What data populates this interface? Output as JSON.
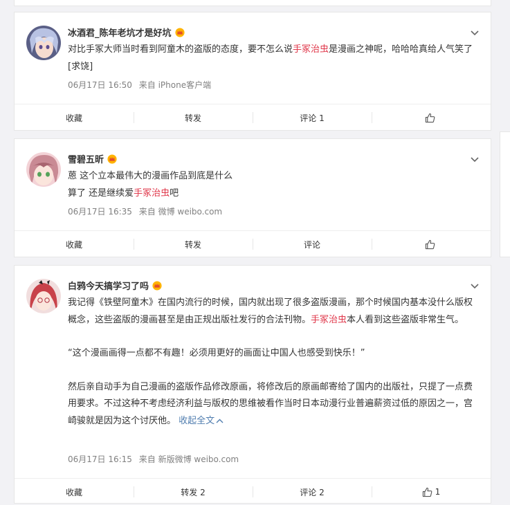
{
  "comments": [
    {
      "username": "冰酒君_陈年老坑才是好坑",
      "text_before": "对比手冢大师当时看到阿童木的盗版的态度，要不怎么说",
      "highlight": "手冢治虫",
      "text_after": "是漫画之神呢，哈哈哈真给人气笑了[求饶]",
      "time": "06月17日 16:50",
      "source": "来自 iPhone客户端",
      "actions": {
        "favorite": "收藏",
        "repost": "转发",
        "comment": "评论 1",
        "like": ""
      }
    },
    {
      "username": "雪碧五昕",
      "line1": "蒽 这个立本最伟大的漫画作品到底是什么",
      "line2_before": "算了 还是继续爱",
      "highlight": "手冢治虫",
      "line2_after": "吧",
      "time": "06月17日 16:35",
      "source": "来自 微博 weibo.com",
      "actions": {
        "favorite": "收藏",
        "repost": "转发",
        "comment": "评论",
        "like": ""
      }
    },
    {
      "username": "白鸦今天搞学习了吗",
      "p1_before": "我记得《铁壁阿童木》在国内流行的时候，国内就出现了很多盗版漫画，那个时候国内基本没什么版权概念，这些盗版的漫画甚至是由正规出版社发行的合法刊物。",
      "highlight": "手冢治虫",
      "p1_after": "本人看到这些盗版非常生气。",
      "p2": "“这个漫画画得一点都不有趣！必须用更好的画面让中国人也感受到快乐！”",
      "p3": "然后亲自动手为自己漫画的盗版作品修改原画，将修改后的原画邮寄给了国内的出版社，只提了一点费用要求。不过这种不考虑经济利益与版权的思维被看作当时日本动漫行业普遍薪资过低的原因之一，宫崎骏就是因为这个讨厌他。",
      "collapse": "收起全文",
      "time": "06月17日 16:15",
      "source": "来自 新版微博 weibo.com",
      "actions": {
        "favorite": "收藏",
        "repost": "转发 2",
        "comment": "评论 2",
        "like": "1"
      }
    }
  ],
  "colors": {
    "highlight": "#eb7350",
    "link": "#507daf",
    "meta": "#808080"
  },
  "icons": {
    "vip": "vip-crown-icon",
    "chevron": "chevron-down-icon",
    "like": "thumbs-up-icon"
  }
}
